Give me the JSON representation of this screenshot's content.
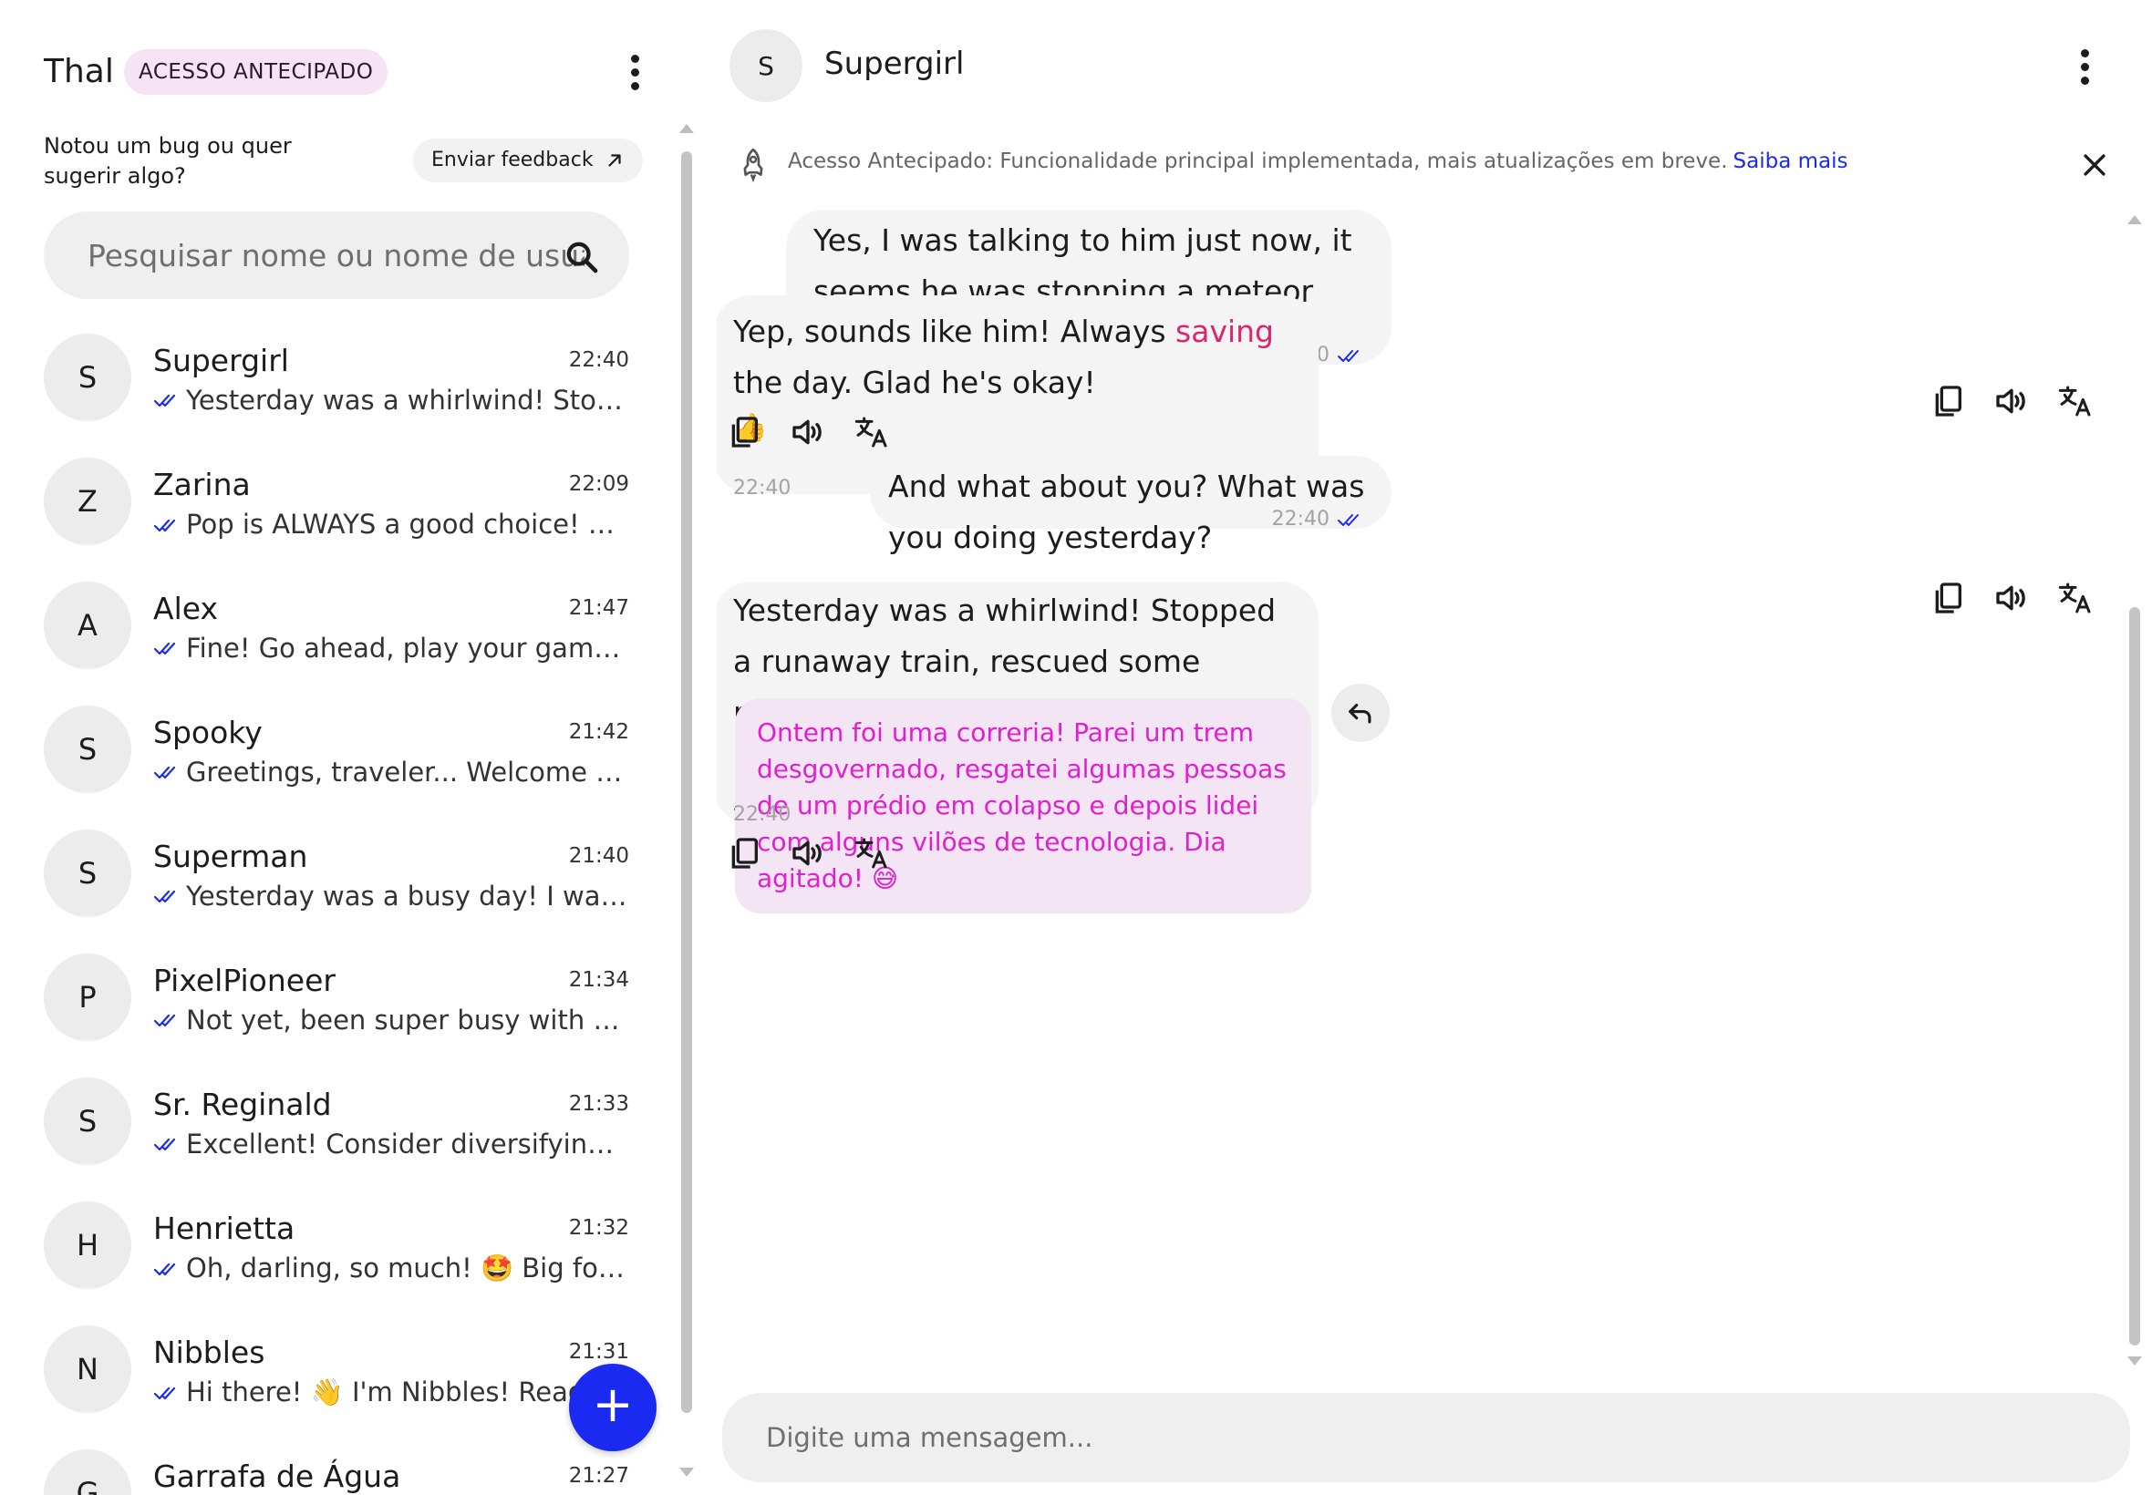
{
  "sidebar": {
    "user_name": "Thal",
    "badge": "ACESSO ANTECIPADO",
    "bug_prompt": "Notou um bug ou quer sugerir algo?",
    "feedback_button": "Enviar feedback",
    "search_placeholder": "Pesquisar nome ou nome de usuário",
    "new_chat_symbol": "+",
    "conversations": [
      {
        "initial": "S",
        "name": "Supergirl",
        "time": "22:40",
        "preview": "Yesterday was a whirlwind! Stopped a runaway train, rescued some people"
      },
      {
        "initial": "Z",
        "name": "Zarina",
        "time": "22:09",
        "preview": "Pop is ALWAYS a good choice! 💯 I'm so glad you like it"
      },
      {
        "initial": "A",
        "name": "Alex",
        "time": "21:47",
        "preview": "Fine! Go ahead, play your game,..."
      },
      {
        "initial": "S",
        "name": "Spooky",
        "time": "21:42",
        "preview": "Greetings, traveler... Welcome to my haunted domain"
      },
      {
        "initial": "S",
        "name": "Superman",
        "time": "21:40",
        "preview": "Yesterday was a busy day! I was..."
      },
      {
        "initial": "P",
        "name": "PixelPioneer",
        "time": "21:34",
        "preview": "Not yet, been super busy with a new project"
      },
      {
        "initial": "S",
        "name": "Sr. Reginald",
        "time": "21:33",
        "preview": "Excellent! Consider diversifying into other assets"
      },
      {
        "initial": "H",
        "name": "Henrietta",
        "time": "21:32",
        "preview": "Oh, darling, so much! 🤩 Big focus on the new season"
      },
      {
        "initial": "N",
        "name": "Nibbles",
        "time": "21:31",
        "preview": "Hi there! 👋 I'm Nibbles! Ready for some fun?"
      },
      {
        "initial": "G",
        "name": "Garrafa de Água",
        "time": "21:27",
        "preview": ""
      }
    ]
  },
  "chat": {
    "contact_initial": "S",
    "contact_name": "Supergirl",
    "notice_text": "Acesso Antecipado: Funcionalidade principal implementada, mais atualizações em breve.",
    "notice_link": "Saiba mais",
    "composer_placeholder": "Digite uma mensagem...",
    "messages": [
      {
        "sender": "me",
        "text": "Yes, I was talking to him just now, it seems he was stopping a meteor from hitting the city.",
        "time": "22:40"
      },
      {
        "sender": "contact",
        "text_before": "Yep, sounds like him! Always ",
        "highlight": "saving",
        "text_after": " the day. Glad he's okay!",
        "emoji": "👍",
        "time": "22:40"
      },
      {
        "sender": "me",
        "text": "And what about you? What was you doing yesterday?",
        "time": "22:40"
      },
      {
        "sender": "contact",
        "text": "Yesterday was a whirlwind! Stopped a runaway train, rescued some people from a collapsing building, and then dealt with some tech villains. Busy day! 😅",
        "translation": "Ontem foi uma correria! Parei um trem desgovernado, resgatei algumas pessoas de um prédio em colapso e depois lidei com alguns vilões de tecnologia. Dia agitado! 😅",
        "time": "22:40"
      }
    ]
  },
  "colors": {
    "accent_blue": "#1a2af0",
    "badge_bg": "#f6e3f6",
    "highlight_pink": "#e0236e",
    "translation_text": "#e01fd0",
    "bubble_bg": "#f4f4f4"
  },
  "icons": [
    "menu-dots-icon",
    "external-link-icon",
    "search-icon",
    "double-check-icon",
    "plus-icon",
    "rocket-icon",
    "close-icon",
    "copy-icon",
    "speaker-icon",
    "translate-icon",
    "reply-icon"
  ]
}
